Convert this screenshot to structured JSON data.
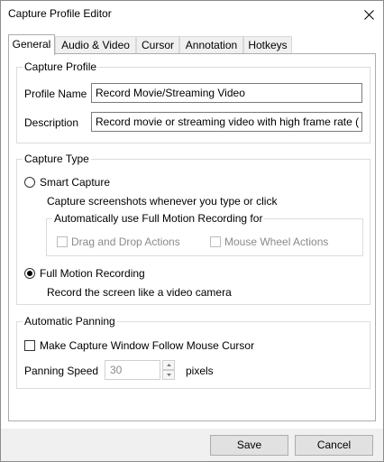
{
  "window": {
    "title": "Capture Profile Editor"
  },
  "tabs": [
    {
      "label": "General",
      "active": true
    },
    {
      "label": "Audio & Video",
      "active": false
    },
    {
      "label": "Cursor",
      "active": false
    },
    {
      "label": "Annotation",
      "active": false
    },
    {
      "label": "Hotkeys",
      "active": false
    }
  ],
  "capture_profile": {
    "title": "Capture Profile",
    "profile_name_label": "Profile Name",
    "profile_name_value": "Record Movie/Streaming Video",
    "description_label": "Description",
    "description_value": "Record movie or streaming video with high frame rate ("
  },
  "capture_type": {
    "title": "Capture Type",
    "smart_capture": {
      "label": "Smart Capture",
      "selected": false,
      "description": "Capture screenshots whenever you type or click"
    },
    "auto_full_motion": {
      "title": "Automatically use Full Motion Recording for",
      "drag_drop_label": "Drag and Drop Actions",
      "mouse_wheel_label": "Mouse Wheel Actions"
    },
    "full_motion": {
      "label": "Full Motion Recording",
      "selected": true,
      "description": "Record the screen like a video camera"
    }
  },
  "automatic_panning": {
    "title": "Automatic Panning",
    "follow_cursor_label": "Make Capture Window Follow Mouse Cursor",
    "speed_label": "Panning Speed",
    "speed_value": "30",
    "speed_unit": "pixels"
  },
  "footer": {
    "save_label": "Save",
    "cancel_label": "Cancel"
  }
}
